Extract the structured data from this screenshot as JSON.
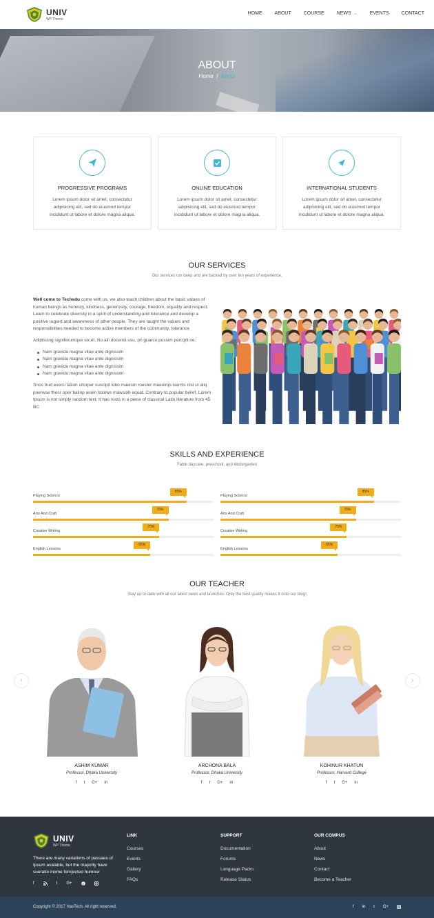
{
  "brand": {
    "name": "UNIV",
    "tagline": "WP Theme",
    "accent": "#3fb9d3",
    "skill_color": "#f0ad1a",
    "footer_bg": "#2f3640",
    "bottom_bg": "#2b4258"
  },
  "nav": {
    "items": [
      "HOME",
      "ABOUT",
      "COURSE",
      "NEWS",
      "EVENTS",
      "CONTACT"
    ]
  },
  "hero": {
    "title": "ABOUT",
    "crumb_home": "Home",
    "crumb_sep": "/",
    "crumb_current": "About"
  },
  "features": [
    {
      "title": "PROGRESSIVE PROGRAMS",
      "text": "Lorem ipsum dolor sit amet, consectetur adipisicing elit, sed do eiusmod tempor incididunt ut labore et dolore magna aliqua.",
      "icon": "paper-plane-icon"
    },
    {
      "title": "ONLINE EDUCATION",
      "text": "Lorem ipsum dolor sit amet, consectetur adipisicing elit, sed do eiusmod tempor incididunt ut labore et dolore magna aliqua.",
      "icon": "check-square-icon"
    },
    {
      "title": "INTERNATIONAL STUDENTS",
      "text": "Lorem ipsum dolor sit amet, consectetur adipisicing elit, sed do eiusmod tempor incididunt ut labore et dolore magna aliqua.",
      "icon": "airplane-icon"
    }
  ],
  "services": {
    "title": "OUR SERVICES",
    "subtitle": "Our services run deep and are backed by over ten years of experience.",
    "lead_bold": "Well come to Techedu",
    "lead_rest": " come with us, we also teach children about the basic values of human beings as honesty, kindness, generosity, courage, freedom, equality and respect. Learn to celebrate diversity in a spirit of understanding and tolerance and develop a positive regard and awareness of other people. They are taught the values and responsibilities needed to become active members of the community, tolerance",
    "para2": "Adipiscing signiferumque vix et. No alii docendi usu, pri graeco possim percipit ne.",
    "bullets": [
      "Nam gravida magna vitae ante dignissim",
      "Nam gravida magna vitae ante dignissim",
      "Nam gravida magna vitae ante dignissim",
      "Nam gravida magna vitae ante dignissim"
    ],
    "para3": "Snos trud exerci tation ullorper suscipit lobo maeism roester maeoirqs iserrtis nisl ut aliq poerwse thesr oper balinp asein hoinws mawsoib equat. Contrary to popular belief, Lorem Ipsum is not simply random text. It has roots in a piece of classical Latin literature from 45 BC"
  },
  "skills": {
    "title": "SKILLS AND EXPERIENCE",
    "subtitle": "Fable daycare, preschool, and kindergarten",
    "left": [
      {
        "label": "Playing Science",
        "value": 85,
        "text": "85%"
      },
      {
        "label": "Arts And Craft",
        "value": 75,
        "text": "75%"
      },
      {
        "label": "Creative Writing",
        "value": 70,
        "text": "70%"
      },
      {
        "label": "English Lessons",
        "value": 65,
        "text": "65%"
      }
    ],
    "right": [
      {
        "label": "Playing Science",
        "value": 85,
        "text": "85%"
      },
      {
        "label": "Arts And Craft",
        "value": 75,
        "text": "75%"
      },
      {
        "label": "Creative Writing",
        "value": 70,
        "text": "70%"
      },
      {
        "label": "English Lessons",
        "value": 65,
        "text": "65%"
      }
    ]
  },
  "teachers": {
    "title": "OUR TEACHER",
    "subtitle": "Stay up to date with all our latest news and launches. Only the best quality makes it onto our blog!",
    "list": [
      {
        "name": "ASHIM KUMAR",
        "role": "Professor, Dhaka University"
      },
      {
        "name": "ARCHONA BALA",
        "role": "Professor, Dhaka University"
      },
      {
        "name": "KOHINUR KHATUN",
        "role": "Professor, Harvard College"
      }
    ],
    "social": [
      "f",
      "t",
      "G+",
      "in"
    ],
    "prev": "‹",
    "next": "›"
  },
  "footer": {
    "desc": "There are many variations of passaes of Ipsum avalable, but the majority have sueratio inome fornjected humour",
    "social": [
      "f",
      "rss",
      "t",
      "G+",
      "p",
      "ig"
    ],
    "col1_title": "LINK",
    "col1": [
      "Courses",
      "Events",
      "Gallery",
      "FAQs"
    ],
    "col2_title": "SUPPORT",
    "col2": [
      "Documentation",
      "Forums",
      "Language Packs",
      "Release Status"
    ],
    "col3_title": "OUR COMPUS",
    "col3": [
      "About",
      "News",
      "Contact",
      "Become a Teacher"
    ],
    "copyright": "Copyright © 2017 HasTech. All right reserved.",
    "bottom_social": [
      "f",
      "in",
      "t",
      "G+",
      "ig"
    ]
  }
}
